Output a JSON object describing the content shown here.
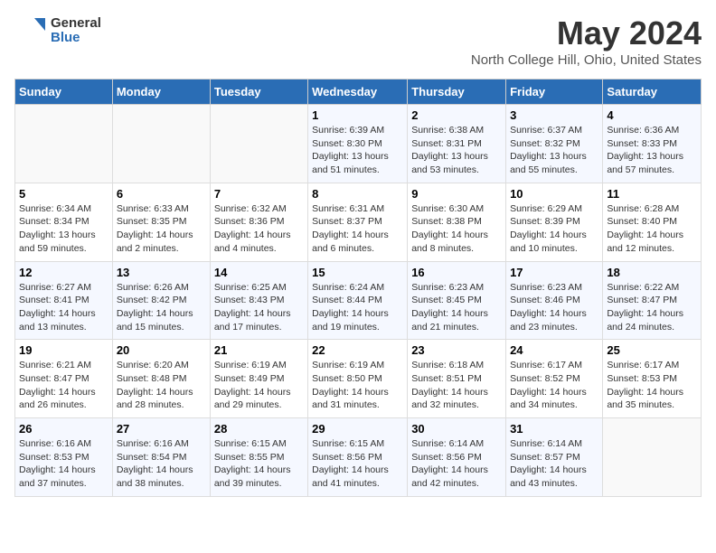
{
  "logo": {
    "text_general": "General",
    "text_blue": "Blue"
  },
  "header": {
    "title": "May 2024",
    "subtitle": "North College Hill, Ohio, United States"
  },
  "columns": [
    "Sunday",
    "Monday",
    "Tuesday",
    "Wednesday",
    "Thursday",
    "Friday",
    "Saturday"
  ],
  "weeks": [
    [
      {
        "day": "",
        "info": ""
      },
      {
        "day": "",
        "info": ""
      },
      {
        "day": "",
        "info": ""
      },
      {
        "day": "1",
        "info": "Sunrise: 6:39 AM\nSunset: 8:30 PM\nDaylight: 13 hours and 51 minutes."
      },
      {
        "day": "2",
        "info": "Sunrise: 6:38 AM\nSunset: 8:31 PM\nDaylight: 13 hours and 53 minutes."
      },
      {
        "day": "3",
        "info": "Sunrise: 6:37 AM\nSunset: 8:32 PM\nDaylight: 13 hours and 55 minutes."
      },
      {
        "day": "4",
        "info": "Sunrise: 6:36 AM\nSunset: 8:33 PM\nDaylight: 13 hours and 57 minutes."
      }
    ],
    [
      {
        "day": "5",
        "info": "Sunrise: 6:34 AM\nSunset: 8:34 PM\nDaylight: 13 hours and 59 minutes."
      },
      {
        "day": "6",
        "info": "Sunrise: 6:33 AM\nSunset: 8:35 PM\nDaylight: 14 hours and 2 minutes."
      },
      {
        "day": "7",
        "info": "Sunrise: 6:32 AM\nSunset: 8:36 PM\nDaylight: 14 hours and 4 minutes."
      },
      {
        "day": "8",
        "info": "Sunrise: 6:31 AM\nSunset: 8:37 PM\nDaylight: 14 hours and 6 minutes."
      },
      {
        "day": "9",
        "info": "Sunrise: 6:30 AM\nSunset: 8:38 PM\nDaylight: 14 hours and 8 minutes."
      },
      {
        "day": "10",
        "info": "Sunrise: 6:29 AM\nSunset: 8:39 PM\nDaylight: 14 hours and 10 minutes."
      },
      {
        "day": "11",
        "info": "Sunrise: 6:28 AM\nSunset: 8:40 PM\nDaylight: 14 hours and 12 minutes."
      }
    ],
    [
      {
        "day": "12",
        "info": "Sunrise: 6:27 AM\nSunset: 8:41 PM\nDaylight: 14 hours and 13 minutes."
      },
      {
        "day": "13",
        "info": "Sunrise: 6:26 AM\nSunset: 8:42 PM\nDaylight: 14 hours and 15 minutes."
      },
      {
        "day": "14",
        "info": "Sunrise: 6:25 AM\nSunset: 8:43 PM\nDaylight: 14 hours and 17 minutes."
      },
      {
        "day": "15",
        "info": "Sunrise: 6:24 AM\nSunset: 8:44 PM\nDaylight: 14 hours and 19 minutes."
      },
      {
        "day": "16",
        "info": "Sunrise: 6:23 AM\nSunset: 8:45 PM\nDaylight: 14 hours and 21 minutes."
      },
      {
        "day": "17",
        "info": "Sunrise: 6:23 AM\nSunset: 8:46 PM\nDaylight: 14 hours and 23 minutes."
      },
      {
        "day": "18",
        "info": "Sunrise: 6:22 AM\nSunset: 8:47 PM\nDaylight: 14 hours and 24 minutes."
      }
    ],
    [
      {
        "day": "19",
        "info": "Sunrise: 6:21 AM\nSunset: 8:47 PM\nDaylight: 14 hours and 26 minutes."
      },
      {
        "day": "20",
        "info": "Sunrise: 6:20 AM\nSunset: 8:48 PM\nDaylight: 14 hours and 28 minutes."
      },
      {
        "day": "21",
        "info": "Sunrise: 6:19 AM\nSunset: 8:49 PM\nDaylight: 14 hours and 29 minutes."
      },
      {
        "day": "22",
        "info": "Sunrise: 6:19 AM\nSunset: 8:50 PM\nDaylight: 14 hours and 31 minutes."
      },
      {
        "day": "23",
        "info": "Sunrise: 6:18 AM\nSunset: 8:51 PM\nDaylight: 14 hours and 32 minutes."
      },
      {
        "day": "24",
        "info": "Sunrise: 6:17 AM\nSunset: 8:52 PM\nDaylight: 14 hours and 34 minutes."
      },
      {
        "day": "25",
        "info": "Sunrise: 6:17 AM\nSunset: 8:53 PM\nDaylight: 14 hours and 35 minutes."
      }
    ],
    [
      {
        "day": "26",
        "info": "Sunrise: 6:16 AM\nSunset: 8:53 PM\nDaylight: 14 hours and 37 minutes."
      },
      {
        "day": "27",
        "info": "Sunrise: 6:16 AM\nSunset: 8:54 PM\nDaylight: 14 hours and 38 minutes."
      },
      {
        "day": "28",
        "info": "Sunrise: 6:15 AM\nSunset: 8:55 PM\nDaylight: 14 hours and 39 minutes."
      },
      {
        "day": "29",
        "info": "Sunrise: 6:15 AM\nSunset: 8:56 PM\nDaylight: 14 hours and 41 minutes."
      },
      {
        "day": "30",
        "info": "Sunrise: 6:14 AM\nSunset: 8:56 PM\nDaylight: 14 hours and 42 minutes."
      },
      {
        "day": "31",
        "info": "Sunrise: 6:14 AM\nSunset: 8:57 PM\nDaylight: 14 hours and 43 minutes."
      },
      {
        "day": "",
        "info": ""
      }
    ]
  ]
}
